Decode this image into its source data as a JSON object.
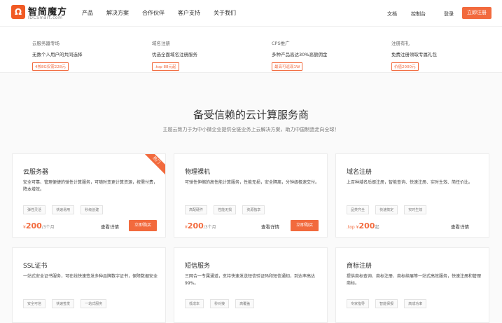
{
  "header": {
    "logo_mark": "Ω",
    "logo_text": "智简魔方",
    "logo_sub": "IDCSmart.com",
    "nav": [
      "产品",
      "解决方案",
      "合作伙伴",
      "客户支持",
      "关于我们"
    ],
    "docs": "文档",
    "console": "控制台",
    "login": "登录",
    "register": "立即注册"
  },
  "promo": [
    {
      "title": "云服务器专场",
      "desc": "无数个人用户的共同选择",
      "tag": "4核8G仅需228元"
    },
    {
      "title": "域名注册",
      "desc": "优选全面域名注册服务",
      "tag": ".top 88元起"
    },
    {
      "title": "CPS推广",
      "desc": "多种产品高达30%高额佣金",
      "tag": "最高可返现1W"
    },
    {
      "title": "注册有礼",
      "desc": "免费注册领取专属礼包",
      "tag": "价值2000元"
    }
  ],
  "section": {
    "title": "备受信赖的云计算服务商",
    "subtitle": "主题云致力于为中小微企业提供全链业务上云解决方案，助力中国制造走向全球！"
  },
  "cards": [
    {
      "title": "云服务器",
      "desc": "安全可靠、管理便捷的弹性计算服务，可随时变更计算资源，按需付费，降本增效。",
      "tags": [
        "弹性灵活",
        "快速易用",
        "秒级创建"
      ],
      "price_prefix": "¥",
      "price": "200",
      "price_suffix": "/3个月",
      "view": "查看详情",
      "buy": "立即购买",
      "hot": "热门"
    },
    {
      "title": "物理裸机",
      "desc": "可弹性伸缩的高性能计算服务，性能无损，安全隔离，分钟级极速交付。",
      "tags": [
        "高配硬件",
        "性能无损",
        "资源独享"
      ],
      "price_prefix": "¥",
      "price": "200",
      "price_suffix": "/3个月",
      "view": "查看详情",
      "buy": "立即购买"
    },
    {
      "title": "域名注册",
      "desc": "上百种域名后缀注册，智能查询、快速注册、实时生效、简任价比。",
      "tags": [
        "品类齐全",
        "快速搞定",
        "实时生效"
      ],
      "price_prefix": ".top ¥",
      "price": "200",
      "price_suffix": "起",
      "view": "查看详情"
    },
    {
      "title": "SSL证书",
      "desc": "一站式安全证书服务，可在线快速签发多种品牌数字证书，保障数据安全",
      "tags": [
        "安全可信",
        "快速签发",
        "一站式服务"
      ]
    },
    {
      "title": "短信服务",
      "desc": "三网合一专属通道，支持快速发送短信验证码和短信通知，到达率高达99%。",
      "tags": [
        "低成本",
        "秒对接",
        "高覆盖"
      ]
    },
    {
      "title": "商标注册",
      "desc": "提供商标查询、商标注册、商标续展等一站式高效服务，快速注册和管理商标。",
      "tags": [
        "专家指导",
        "智能保报",
        "高成功率"
      ]
    }
  ],
  "colors": {
    "accent": "#f26a3d"
  }
}
